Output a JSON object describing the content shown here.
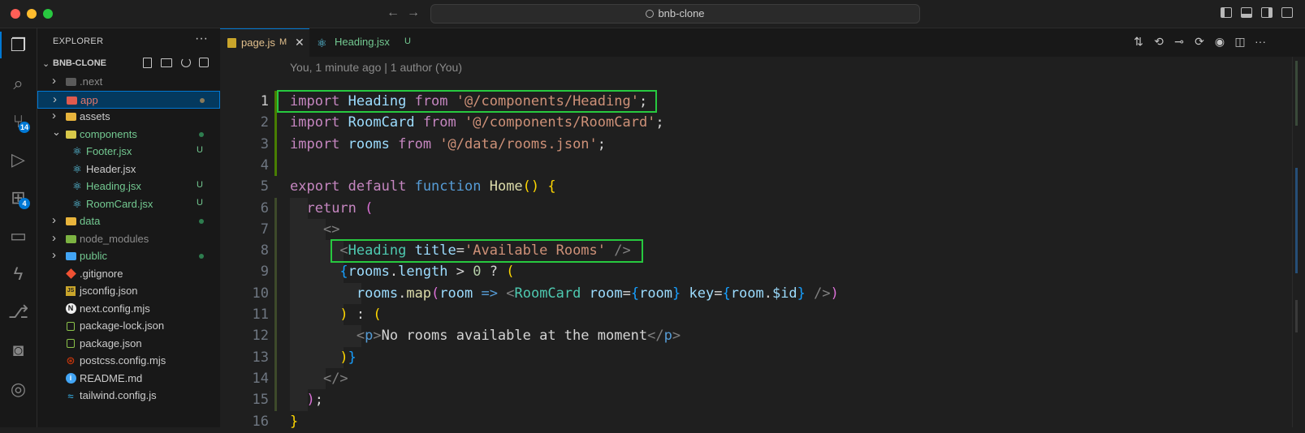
{
  "window": {
    "search_text": "bnb-clone",
    "traffic_lights": [
      "#ff5f57",
      "#febc2e",
      "#28c840"
    ]
  },
  "activity_bar": {
    "items": [
      {
        "icon": "files-icon"
      },
      {
        "icon": "search-icon"
      },
      {
        "icon": "source-control-icon",
        "badge": "14"
      },
      {
        "icon": "run-debug-icon"
      },
      {
        "icon": "extensions-icon",
        "badge": "4"
      },
      {
        "icon": "remote-explorer-icon"
      },
      {
        "icon": "lightning-icon"
      },
      {
        "icon": "git-graph-icon"
      },
      {
        "icon": "docker-icon"
      },
      {
        "icon": "gitlens-icon"
      }
    ]
  },
  "explorer": {
    "title": "EXPLORER",
    "more": "···",
    "project": "BNB-CLONE",
    "tree": [
      {
        "name": ".next",
        "type": "folder",
        "open": false,
        "indent": 0,
        "color": "#8c8c8c",
        "icon_color": "#5a5a5a"
      },
      {
        "name": "app",
        "type": "folder",
        "open": false,
        "indent": 0,
        "color": "#e2776b",
        "icon_color": "#e05a4e",
        "selected": true,
        "status_dot": "#8a7a5a"
      },
      {
        "name": "assets",
        "type": "folder",
        "open": false,
        "indent": 0,
        "color": "#cccccc",
        "icon_color": "#e8b43c"
      },
      {
        "name": "components",
        "type": "folder",
        "open": true,
        "indent": 0,
        "color": "#73c991",
        "icon_color": "#d8c84a",
        "status_dot": "#2e7d4f"
      },
      {
        "name": "Footer.jsx",
        "type": "react",
        "indent": 1,
        "color": "#73c991",
        "status": "U"
      },
      {
        "name": "Header.jsx",
        "type": "react",
        "indent": 1,
        "color": "#cccccc"
      },
      {
        "name": "Heading.jsx",
        "type": "react",
        "indent": 1,
        "color": "#73c991",
        "status": "U"
      },
      {
        "name": "RoomCard.jsx",
        "type": "react",
        "indent": 1,
        "color": "#73c991",
        "status": "U"
      },
      {
        "name": "data",
        "type": "folder",
        "open": false,
        "indent": 0,
        "color": "#73c991",
        "icon_color": "#e8b43c",
        "status_dot": "#2e7d4f"
      },
      {
        "name": "node_modules",
        "type": "folder",
        "open": false,
        "indent": 0,
        "color": "#8c8c8c",
        "icon_color": "#7cb342"
      },
      {
        "name": "public",
        "type": "folder",
        "open": false,
        "indent": 0,
        "color": "#73c991",
        "icon_color": "#42a5f5",
        "status_dot": "#2e7d4f"
      },
      {
        "name": ".gitignore",
        "type": "git",
        "indent": 0,
        "color": "#cccccc"
      },
      {
        "name": "jsconfig.json",
        "type": "jsconf",
        "indent": 0,
        "color": "#cccccc"
      },
      {
        "name": "next.config.mjs",
        "type": "next",
        "indent": 0,
        "color": "#cccccc"
      },
      {
        "name": "package-lock.json",
        "type": "npm",
        "indent": 0,
        "color": "#cccccc"
      },
      {
        "name": "package.json",
        "type": "npm",
        "indent": 0,
        "color": "#cccccc"
      },
      {
        "name": "postcss.config.mjs",
        "type": "postcss",
        "indent": 0,
        "color": "#cccccc"
      },
      {
        "name": "README.md",
        "type": "info",
        "indent": 0,
        "color": "#cccccc"
      },
      {
        "name": "tailwind.config.js",
        "type": "tailwind",
        "indent": 0,
        "color": "#cccccc"
      }
    ]
  },
  "tabs": [
    {
      "label": "page.js",
      "status": "M",
      "active": true,
      "color": "#e2c08d"
    },
    {
      "label": "Heading.jsx",
      "status": "U",
      "active": false,
      "color": "#73c991"
    }
  ],
  "editor": {
    "blame": "You, 1 minute ago | 1 author (You)",
    "lines": [
      {
        "n": "1",
        "tokens": [
          [
            "kw",
            "import"
          ],
          [
            "txt",
            " "
          ],
          [
            "id",
            "Heading"
          ],
          [
            "txt",
            " "
          ],
          [
            "kw",
            "from"
          ],
          [
            "txt",
            " "
          ],
          [
            "str",
            "'@/components/Heading'"
          ],
          [
            "txt",
            ";"
          ]
        ]
      },
      {
        "n": "2",
        "tokens": [
          [
            "kw",
            "import"
          ],
          [
            "txt",
            " "
          ],
          [
            "id",
            "RoomCard"
          ],
          [
            "txt",
            " "
          ],
          [
            "kw",
            "from"
          ],
          [
            "txt",
            " "
          ],
          [
            "str",
            "'@/components/RoomCard'"
          ],
          [
            "txt",
            ";"
          ]
        ]
      },
      {
        "n": "3",
        "tokens": [
          [
            "kw",
            "import"
          ],
          [
            "txt",
            " "
          ],
          [
            "id",
            "rooms"
          ],
          [
            "txt",
            " "
          ],
          [
            "kw",
            "from"
          ],
          [
            "txt",
            " "
          ],
          [
            "str",
            "'@/data/rooms.json'"
          ],
          [
            "txt",
            ";"
          ]
        ]
      },
      {
        "n": "4",
        "tokens": []
      },
      {
        "n": "5",
        "tokens": [
          [
            "kw",
            "export"
          ],
          [
            "txt",
            " "
          ],
          [
            "kw",
            "default"
          ],
          [
            "txt",
            " "
          ],
          [
            "kw2",
            "function"
          ],
          [
            "txt",
            " "
          ],
          [
            "fn",
            "Home"
          ],
          [
            "p1",
            "()"
          ],
          [
            "txt",
            " "
          ],
          [
            "p1",
            "{"
          ]
        ]
      },
      {
        "n": "6",
        "tokens": [
          [
            "txt",
            "  "
          ],
          [
            "kw",
            "return"
          ],
          [
            "txt",
            " "
          ],
          [
            "p2",
            "("
          ]
        ]
      },
      {
        "n": "7",
        "tokens": [
          [
            "txt",
            "    "
          ],
          [
            "ang",
            "<>"
          ]
        ]
      },
      {
        "n": "8",
        "tokens": [
          [
            "txt",
            "      "
          ],
          [
            "ang",
            "<"
          ],
          [
            "tag",
            "Heading"
          ],
          [
            "txt",
            " "
          ],
          [
            "id",
            "title"
          ],
          [
            "txt",
            "="
          ],
          [
            "str",
            "'Available Rooms'"
          ],
          [
            "txt",
            " "
          ],
          [
            "ang",
            "/>"
          ]
        ]
      },
      {
        "n": "9",
        "tokens": [
          [
            "txt",
            "      "
          ],
          [
            "p3",
            "{"
          ],
          [
            "id",
            "rooms"
          ],
          [
            "txt",
            "."
          ],
          [
            "id",
            "length"
          ],
          [
            "txt",
            " > "
          ],
          [
            "num",
            "0"
          ],
          [
            "txt",
            " ? "
          ],
          [
            "p1",
            "("
          ]
        ]
      },
      {
        "n": "10",
        "tokens": [
          [
            "txt",
            "        "
          ],
          [
            "id",
            "rooms"
          ],
          [
            "txt",
            "."
          ],
          [
            "fn",
            "map"
          ],
          [
            "p2",
            "("
          ],
          [
            "id",
            "room"
          ],
          [
            "txt",
            " "
          ],
          [
            "kw2",
            "=>"
          ],
          [
            "txt",
            " "
          ],
          [
            "ang",
            "<"
          ],
          [
            "tag",
            "RoomCard"
          ],
          [
            "txt",
            " "
          ],
          [
            "id",
            "room"
          ],
          [
            "txt",
            "="
          ],
          [
            "p3",
            "{"
          ],
          [
            "id",
            "room"
          ],
          [
            "p3",
            "}"
          ],
          [
            "txt",
            " "
          ],
          [
            "id",
            "key"
          ],
          [
            "txt",
            "="
          ],
          [
            "p3",
            "{"
          ],
          [
            "id",
            "room"
          ],
          [
            "txt",
            "."
          ],
          [
            "id",
            "$id"
          ],
          [
            "p3",
            "}"
          ],
          [
            "txt",
            " "
          ],
          [
            "ang",
            "/>"
          ],
          [
            "p2",
            ")"
          ]
        ]
      },
      {
        "n": "11",
        "tokens": [
          [
            "txt",
            "      "
          ],
          [
            "p1",
            ")"
          ],
          [
            "txt",
            " : "
          ],
          [
            "p1",
            "("
          ]
        ]
      },
      {
        "n": "12",
        "tokens": [
          [
            "txt",
            "        "
          ],
          [
            "ang",
            "<"
          ],
          [
            "kw2",
            "p"
          ],
          [
            "ang",
            ">"
          ],
          [
            "txt",
            "No rooms available at the moment"
          ],
          [
            "ang",
            "</"
          ],
          [
            "kw2",
            "p"
          ],
          [
            "ang",
            ">"
          ]
        ]
      },
      {
        "n": "13",
        "tokens": [
          [
            "txt",
            "      "
          ],
          [
            "p1",
            ")"
          ],
          [
            "p3",
            "}"
          ]
        ]
      },
      {
        "n": "14",
        "tokens": [
          [
            "txt",
            "    "
          ],
          [
            "ang",
            "</>"
          ]
        ]
      },
      {
        "n": "15",
        "tokens": [
          [
            "txt",
            "  "
          ],
          [
            "p2",
            ")"
          ],
          [
            "txt",
            ";"
          ]
        ]
      },
      {
        "n": "16",
        "tokens": [
          [
            "p1",
            "}"
          ]
        ]
      }
    ],
    "highlight_color": "#27c93f"
  }
}
